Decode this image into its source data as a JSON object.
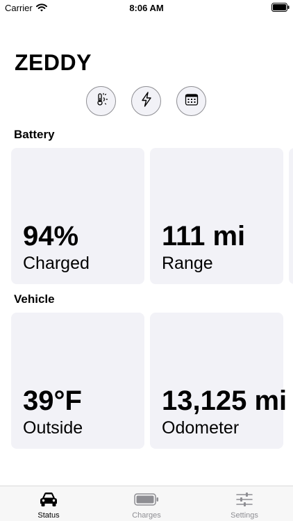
{
  "status_bar": {
    "carrier": "Carrier",
    "time": "8:06 AM"
  },
  "app": {
    "title": "ZEDDY"
  },
  "actions": [
    {
      "icon": "thermometer-sun-icon"
    },
    {
      "icon": "bolt-icon"
    },
    {
      "icon": "calendar-icon"
    }
  ],
  "battery": {
    "heading": "Battery",
    "charged_value": "94%",
    "charged_label": "Charged",
    "range_value": "111 mi",
    "range_label": "Range"
  },
  "vehicle": {
    "heading": "Vehicle",
    "outside_value": "39°F",
    "outside_label": "Outside",
    "odometer_value": "13,125 mi",
    "odometer_label": "Odometer"
  },
  "tabs": [
    {
      "label": "Status",
      "icon": "car-icon",
      "selected": true
    },
    {
      "label": "Charges",
      "icon": "battery-icon",
      "selected": false
    },
    {
      "label": "Settings",
      "icon": "sliders-icon",
      "selected": false
    }
  ],
  "colors": {
    "card_background": "#f2f2f7",
    "tab_selected": "#000000",
    "tab_unselected": "#8e8e93"
  }
}
